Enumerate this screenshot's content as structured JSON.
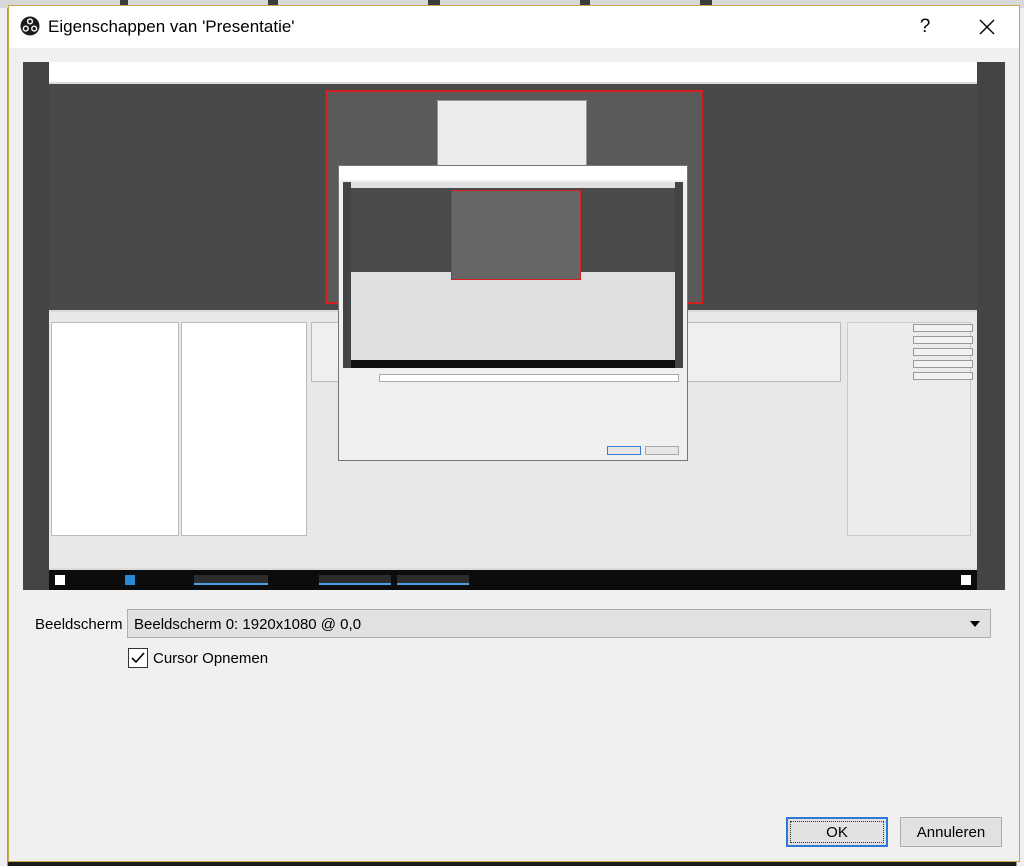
{
  "dialog": {
    "title": "Eigenschappen van 'Presentatie'",
    "help_icon": "question-mark-icon",
    "help_label": "?",
    "close_icon": "close-icon",
    "app_icon": "obs-logo-icon"
  },
  "form": {
    "display_label": "Beeldscherm",
    "display_value": "Beeldscherm 0: 1920x1080 @ 0,0",
    "cursor_label": "Cursor Opnemen",
    "cursor_checked": true
  },
  "buttons": {
    "ok_label": "OK",
    "cancel_label": "Annuleren"
  },
  "colors": {
    "accent": "#2d7ad6",
    "preview_background": "#444444",
    "selection_border": "#d81f1f"
  }
}
